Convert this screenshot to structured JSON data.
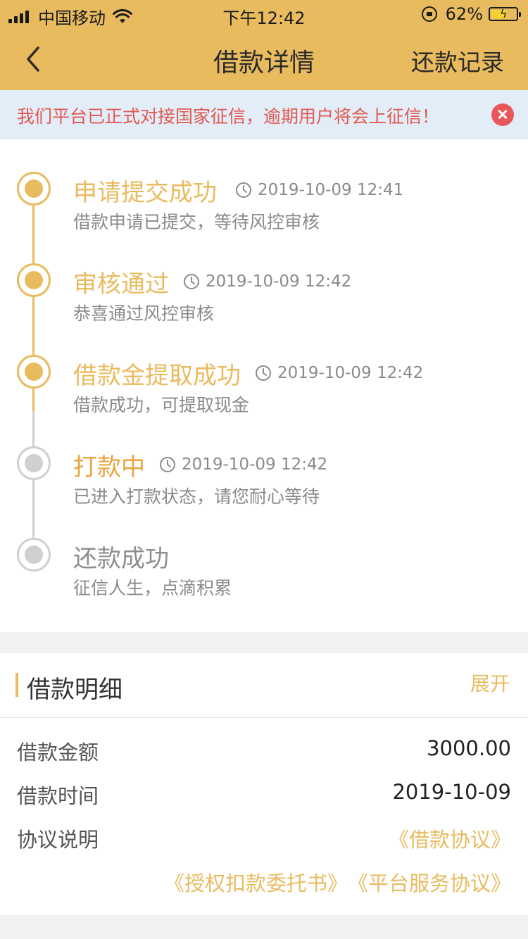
{
  "status_bar": {
    "carrier": "中国移动",
    "time": "下午12:42",
    "battery_percent_text": "62%",
    "battery_level": 0.62
  },
  "nav": {
    "title": "借款详情",
    "right_action": "还款记录"
  },
  "notice": {
    "text": "我们平台已正式对接国家征信，逾期用户将会上征信！"
  },
  "timeline": [
    {
      "title": "申请提交成功",
      "time": "2019-10-09 12:41",
      "desc": "借款申请已提交，等待风控审核",
      "state": "done"
    },
    {
      "title": "审核通过",
      "time": "2019-10-09 12:42",
      "desc": "恭喜通过风控审核",
      "state": "done"
    },
    {
      "title": "借款金提取成功",
      "time": "2019-10-09 12:42",
      "desc": "借款成功，可提取现金",
      "state": "done"
    },
    {
      "title": "打款中",
      "time": "2019-10-09 12:42",
      "desc": "已进入打款状态，请您耐心等待",
      "state": "active"
    },
    {
      "title": "还款成功",
      "time": "",
      "desc": "征信人生，点滴积累",
      "state": "todo"
    }
  ],
  "detail": {
    "title": "借款明细",
    "expand_label": "展开",
    "amount_label": "借款金额",
    "amount_value": "3000.00",
    "time_label": "借款时间",
    "time_value": "2019-10-09",
    "agreement_label": "协议说明",
    "agreements": [
      "《借款协议》",
      "《授权扣款委托书》",
      "《平台服务协议》"
    ]
  },
  "colors": {
    "accent": "#e9bb5f",
    "active_title": "#e9a53f",
    "notice_text": "#e05a52",
    "notice_bg": "#e3edf8",
    "inactive": "#d0d0d0"
  }
}
